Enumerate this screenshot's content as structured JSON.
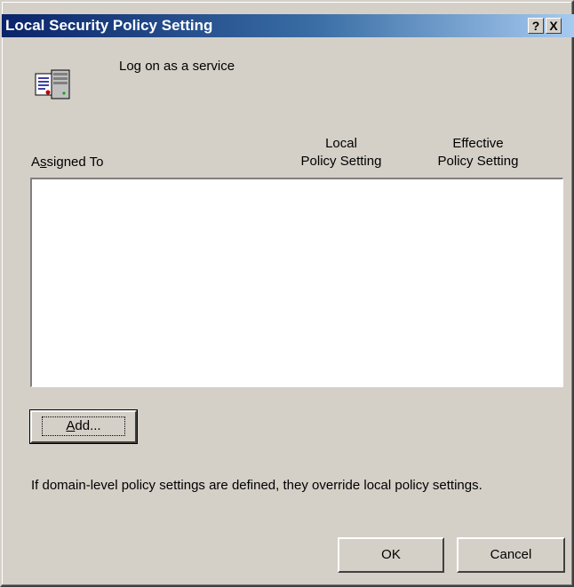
{
  "window": {
    "title": "Local Security Policy Setting",
    "help_label": "?",
    "close_label": "X"
  },
  "policy": {
    "icon": "policy-server-icon",
    "name": "Log on as a service"
  },
  "columns": {
    "assigned_to": {
      "prefix": "A",
      "accel": "s",
      "rest": "signed To"
    },
    "local_policy": [
      "Local",
      "Policy Setting"
    ],
    "effective_policy": [
      "Effective",
      "Policy Setting"
    ]
  },
  "assigned_list": [],
  "buttons": {
    "add": {
      "accel": "A",
      "rest": "dd..."
    },
    "ok": "OK",
    "cancel": "Cancel"
  },
  "note": "If domain-level policy settings are defined, they override local policy settings.",
  "colors": {
    "titlebar_start": "#0a246a",
    "titlebar_end": "#a6caf0",
    "dialog_face": "#d4d0c8"
  }
}
